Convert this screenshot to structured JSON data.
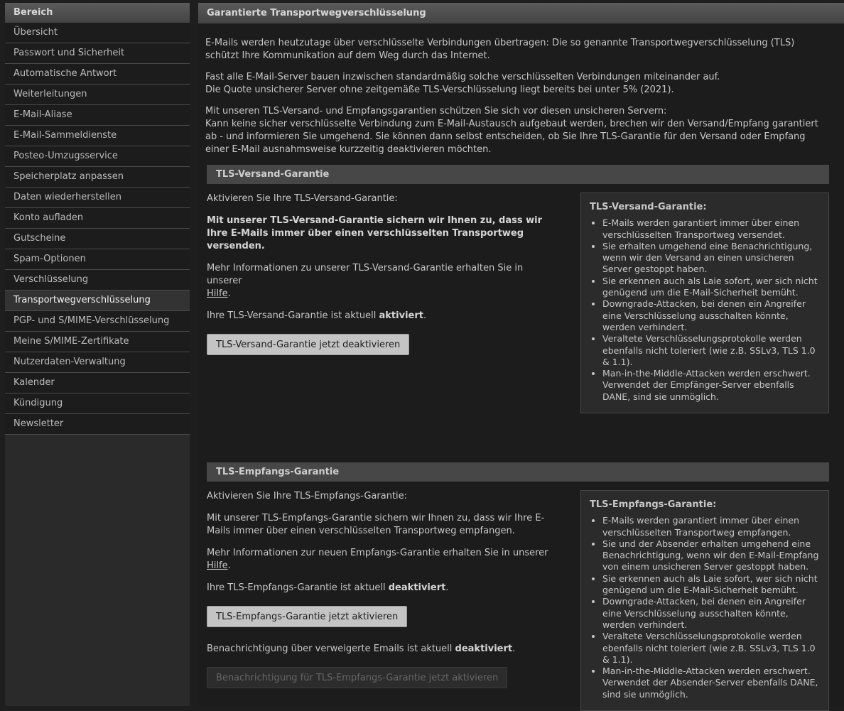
{
  "sidebar": {
    "header": "Bereich",
    "items": [
      "Übersicht",
      "Passwort und Sicherheit",
      "Automatische Antwort",
      "Weiterleitungen",
      "E-Mail-Aliase",
      "E-Mail-Sammeldienste",
      "Posteo-Umzugsservice",
      "Speicherplatz anpassen",
      "Daten wiederherstellen",
      "Konto aufladen",
      "Gutscheine",
      "Spam-Optionen",
      "Verschlüsselung",
      "Transportwegverschlüsselung",
      "PGP- und S/MIME-Verschlüsselung",
      "Meine S/MIME-Zertifikate",
      "Nutzerdaten-Verwaltung",
      "Kalender",
      "Kündigung",
      "Newsletter"
    ],
    "active_index": 13
  },
  "main": {
    "title": "Garantierte Transportwegverschlüsselung",
    "intro_p1": "E-Mails werden heutzutage über verschlüsselte Verbindungen übertragen: Die so genannte Transportwegverschlüsselung (TLS) schützt Ihre Kommunikation auf dem Weg durch das Internet.",
    "intro_p2_line1": "Fast alle E-Mail-Server bauen inzwischen standardmäßig solche verschlüsselten Verbindungen miteinander auf.",
    "intro_p2_line2": "Die Quote unsicherer Server ohne zeitgemäße TLS-Verschlüsselung liegt bereits bei unter 5% (2021).",
    "intro_p3_line1": "Mit unseren TLS-Versand- und Empfangsgarantien schützen Sie sich vor diesen unsicheren Servern:",
    "intro_p3_line2": "Kann keine sicher verschlüsselte Verbindung zum E-Mail-Austausch aufgebaut werden, brechen wir den Versand/Empfang garantiert ab - und informieren Sie umgehend. Sie können dann selbst entscheiden, ob Sie Ihre TLS-Garantie für den Versand oder Empfang einer E-Mail ausnahmsweise kurzzeitig deaktivieren möchten."
  },
  "versand": {
    "header": "TLS-Versand-Garantie",
    "activate_label": "Aktivieren Sie Ihre TLS-Versand-Garantie:",
    "promise": "Mit unserer TLS-Versand-Garantie sichern wir Ihnen zu, dass wir Ihre E-Mails immer über einen verschlüsselten Transportweg versenden.",
    "more_info": "Mehr Informationen zu unserer TLS-Versand-Garantie erhalten Sie in unserer",
    "help_link": "Hilfe",
    "status_prefix": "Ihre TLS-Versand-Garantie ist aktuell",
    "status_value": "aktiviert",
    "button": "TLS-Versand-Garantie jetzt deaktivieren",
    "box_title": "TLS-Versand-Garantie:",
    "box_items": [
      "E-Mails werden garantiert immer über einen verschlüsselten Transportweg versendet.",
      "Sie erhalten umgehend eine Benachrichtigung, wenn wir den Versand an einen unsicheren Server gestoppt haben.",
      "Sie erkennen auch als Laie sofort, wer sich nicht genügend um die E-Mail-Sicherheit bemüht.",
      "Downgrade-Attacken, bei denen ein Angreifer eine Verschlüsselung ausschalten könnte, werden verhindert.",
      "Veraltete Verschlüsselungsprotokolle werden ebenfalls nicht toleriert (wie z.B. SSLv3, TLS 1.0 & 1.1).",
      "Man-in-the-Middle-Attacken werden erschwert. Verwendet der Empfänger-Server ebenfalls DANE, sind sie unmöglich."
    ]
  },
  "empfang": {
    "header": "TLS-Empfangs-Garantie",
    "activate_label": "Aktivieren Sie Ihre TLS-Empfangs-Garantie:",
    "promise": "Mit unserer TLS-Empfangs-Garantie sichern wir Ihnen zu, dass wir Ihre E-Mails immer über einen verschlüsselten Transportweg empfangen.",
    "more_info": "Mehr Informationen zur neuen Empfangs-Garantie erhalten Sie in unserer",
    "help_link": "Hilfe",
    "status_prefix": "Ihre TLS-Empfangs-Garantie ist aktuell",
    "status_value": "deaktiviert",
    "button": "TLS-Empfangs-Garantie jetzt aktivieren",
    "notify_prefix": "Benachrichtigung über verweigerte Emails ist aktuell",
    "notify_value": "deaktiviert",
    "notify_button": "Benachrichtigung für TLS-Empfangs-Garantie jetzt aktivieren",
    "box_title": "TLS-Empfangs-Garantie:",
    "box_items": [
      "E-Mails werden garantiert immer über einen verschlüsselten Transportweg empfangen.",
      "Sie und der Absender erhalten umgehend eine Benachrichtigung, wenn wir den E-Mail-Empfang von einem unsicheren Server gestoppt haben.",
      "Sie erkennen auch als Laie sofort, wer sich nicht genügend um die E-Mail-Sicherheit bemüht.",
      "Downgrade-Attacken, bei denen ein Angreifer eine Verschlüsselung ausschalten könnte, werden verhindert.",
      "Veraltete Verschlüsselungsprotokolle werden ebenfalls nicht toleriert (wie z.B. SSLv3, TLS 1.0 & 1.1).",
      "Man-in-the-Middle-Attacken werden erschwert. Verwendet der Absender-Server ebenfalls DANE, sind sie unmöglich."
    ]
  }
}
